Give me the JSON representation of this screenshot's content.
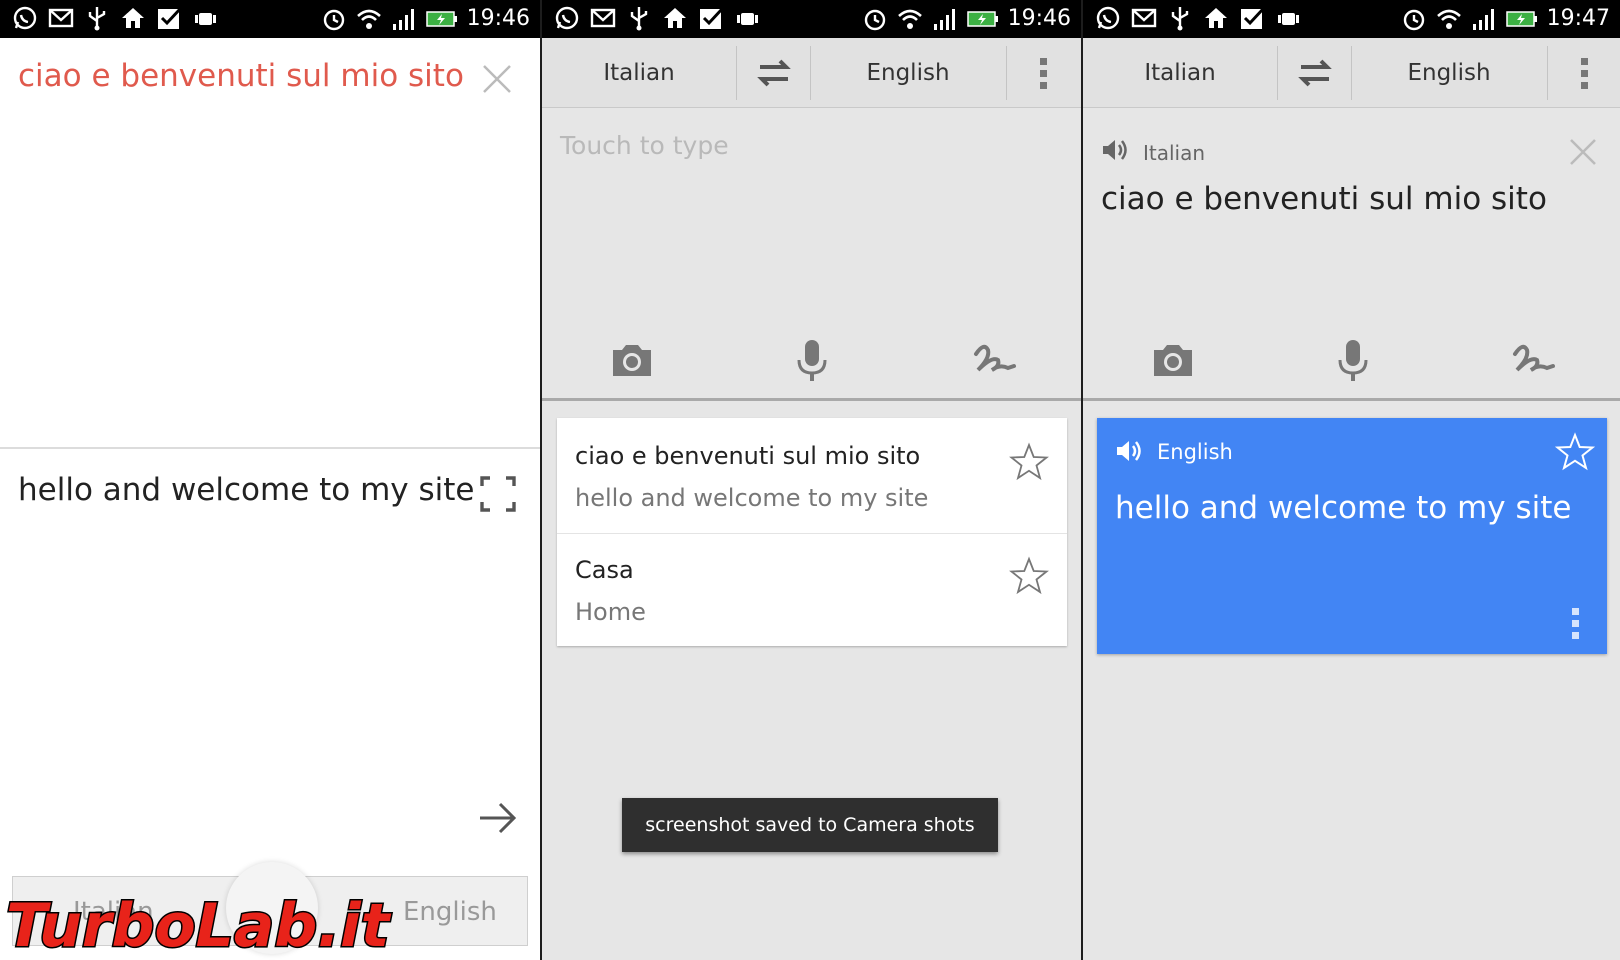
{
  "panel1": {
    "status_time": "19:46",
    "source_text": "ciao e benvenuti sul mio sito",
    "translation_text": "hello and welcome to my site",
    "bottom_lang_left": "Italian",
    "bottom_lang_right": "English",
    "watermark": "TurboLab.it"
  },
  "panel2": {
    "status_time": "19:46",
    "source_lang": "Italian",
    "target_lang": "English",
    "input_placeholder": "Touch to type",
    "history": [
      {
        "source": "ciao e benvenuti sul mio sito",
        "translation": "hello and welcome to my site"
      },
      {
        "source": "Casa",
        "translation": "Home"
      }
    ],
    "toast": "screenshot saved to Camera shots"
  },
  "panel3": {
    "status_time": "19:47",
    "source_lang": "Italian",
    "target_lang": "English",
    "input_lang_label": "Italian",
    "input_text": "ciao e benvenuti sul mio sito",
    "result_lang_label": "English",
    "result_text": "hello and welcome to my site"
  },
  "colors": {
    "accent_blue": "#4285f4",
    "source_red": "#e05a4d",
    "statusbar": "#000000"
  },
  "icons": [
    "whatsapp-icon",
    "gmail-icon",
    "usb-icon",
    "home-icon",
    "checkbox-icon",
    "android-icon",
    "alarm-icon",
    "wifi-icon",
    "signal-icon",
    "battery-icon",
    "swap-icon",
    "overflow-menu-icon",
    "camera-icon",
    "microphone-icon",
    "handwriting-icon",
    "star-icon",
    "close-icon",
    "fullscreen-icon",
    "arrow-right-icon",
    "speaker-icon"
  ]
}
